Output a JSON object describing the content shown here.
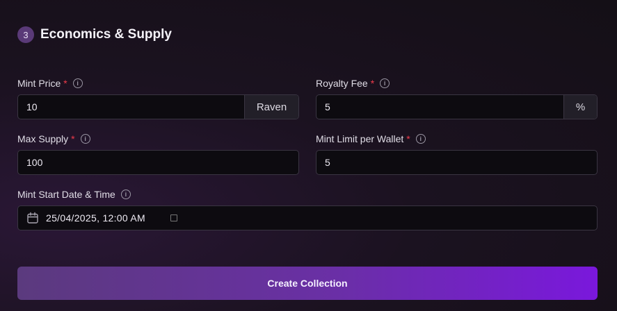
{
  "section": {
    "step": "3",
    "title": "Economics & Supply"
  },
  "fields": {
    "mint_price": {
      "label": "Mint Price",
      "value": "10",
      "addon": "Raven"
    },
    "royalty_fee": {
      "label": "Royalty Fee",
      "value": "5",
      "addon": "%"
    },
    "max_supply": {
      "label": "Max Supply",
      "value": "100"
    },
    "mint_limit": {
      "label": "Mint Limit per Wallet",
      "value": "5"
    },
    "mint_start": {
      "label": "Mint Start Date & Time",
      "value": "25/04/2025, 12:00 AM"
    }
  },
  "required_marker": "*",
  "info_glyph": "i",
  "button": {
    "label": "Create Collection"
  },
  "colors": {
    "accent_start": "#5b3a7e",
    "accent_end": "#7a18dc",
    "required": "#ef3b4b"
  }
}
